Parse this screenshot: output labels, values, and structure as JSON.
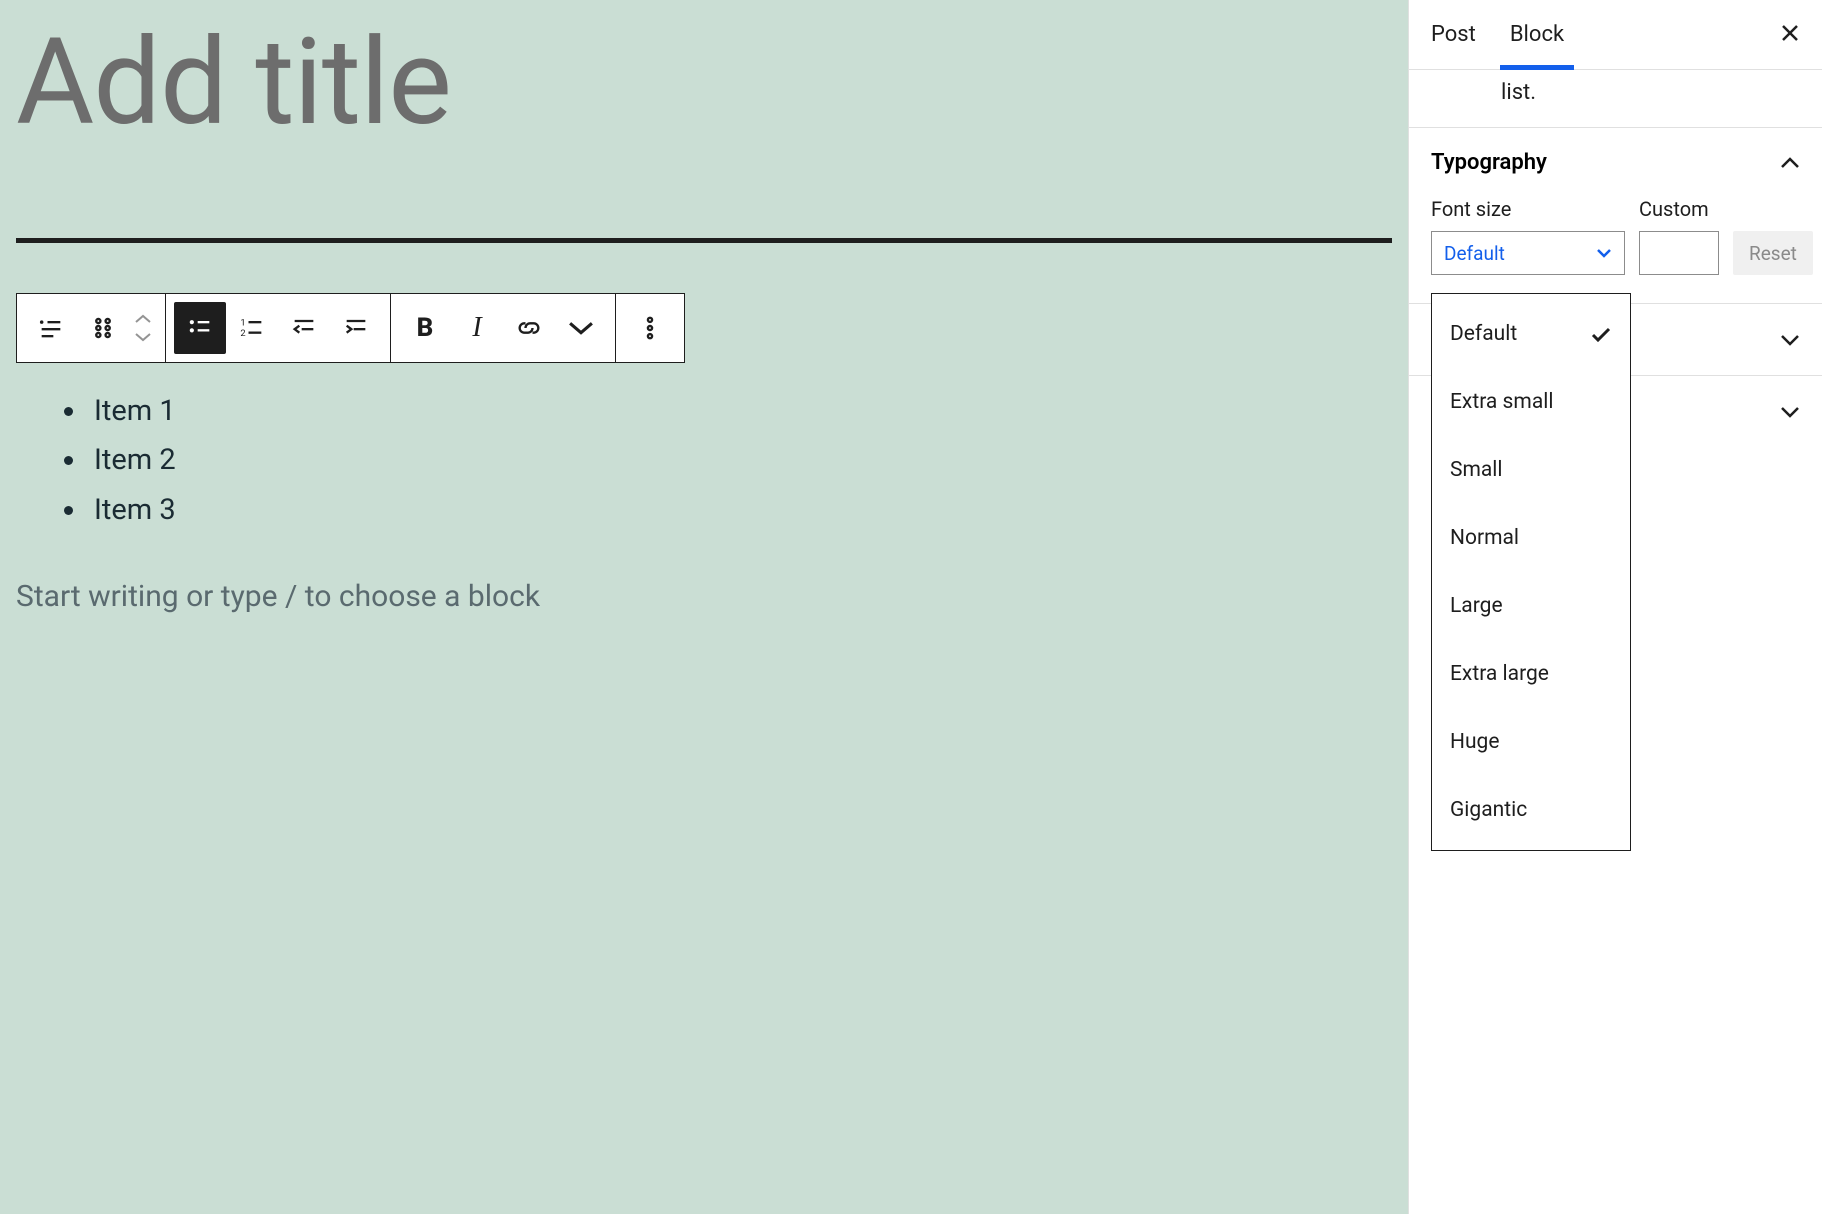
{
  "editor": {
    "title_placeholder": "Add title",
    "list_items": [
      "Item 1",
      "Item 2",
      "Item 3"
    ],
    "slash_prompt": "Start writing or type / to choose a block"
  },
  "sidebar": {
    "tabs": {
      "post": "Post",
      "block": "Block"
    },
    "block_desc_fragment": "list.",
    "typography": {
      "title": "Typography",
      "font_size_label": "Font size",
      "custom_label": "Custom",
      "selected": "Default",
      "reset_label": "Reset",
      "options": [
        "Default",
        "Extra small",
        "Small",
        "Normal",
        "Large",
        "Extra large",
        "Huge",
        "Gigantic"
      ]
    }
  }
}
